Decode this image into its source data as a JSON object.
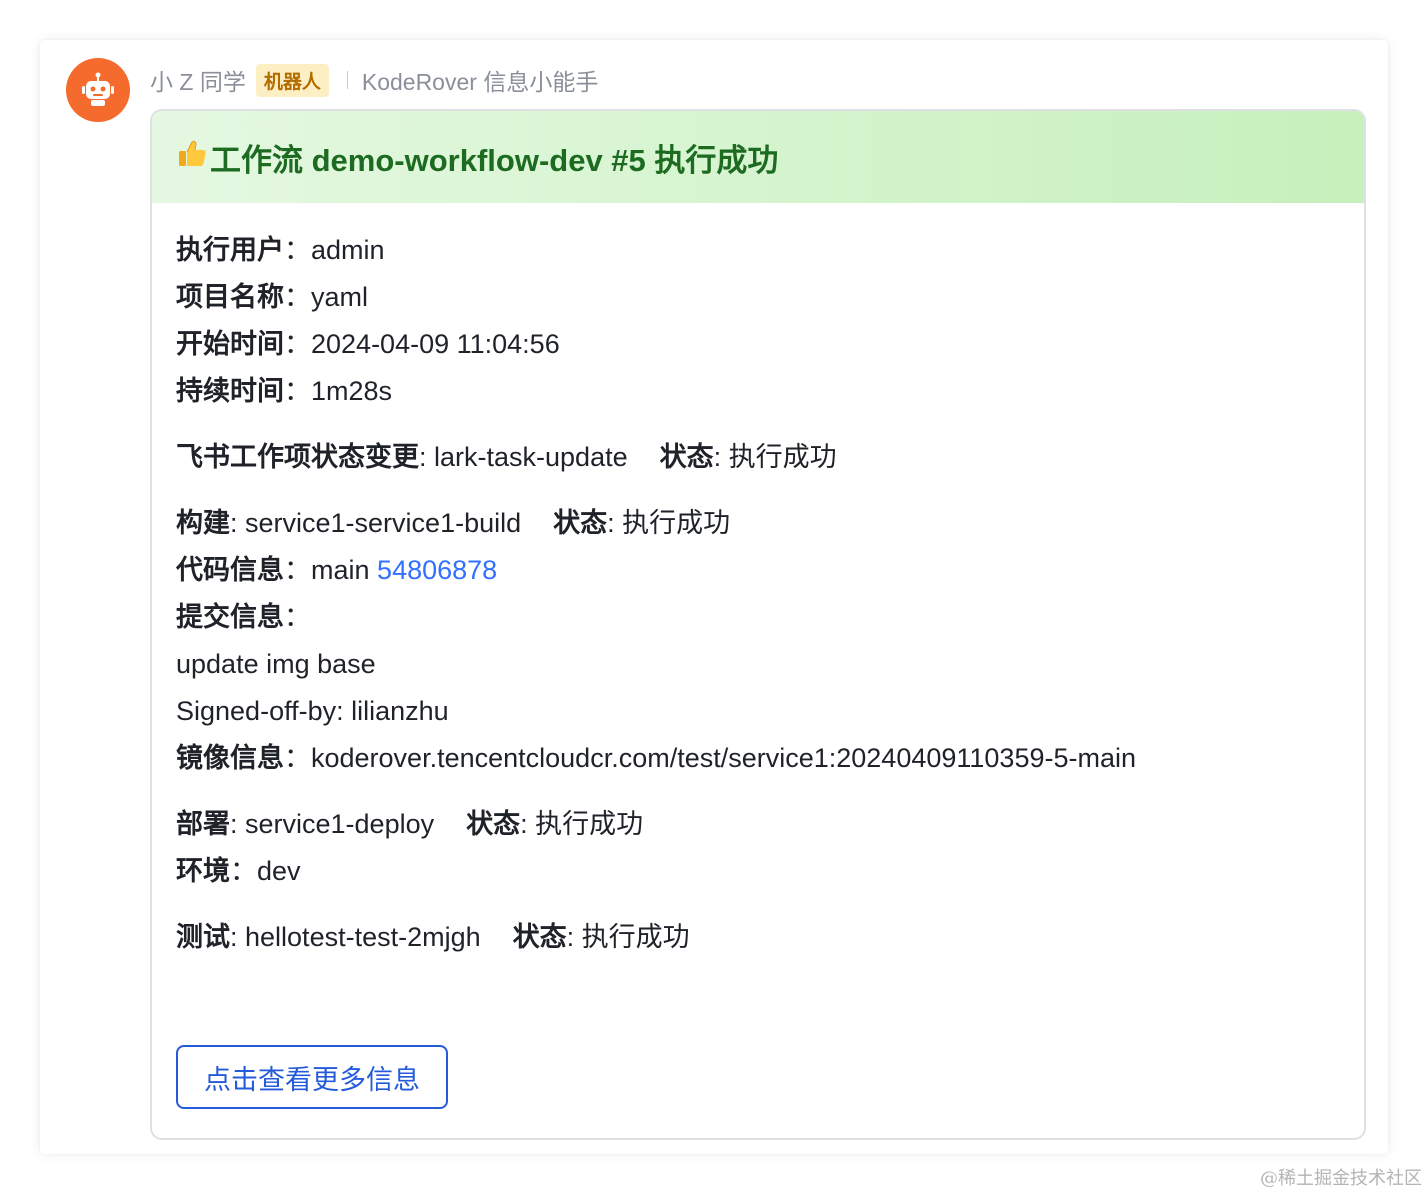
{
  "sender": {
    "name": "小 Z 同学",
    "badge": "机器人",
    "group": "KodeRover 信息小能手",
    "avatar_icon": "robot-icon",
    "avatar_color": "#f56a2d"
  },
  "card": {
    "title_icon": "thumbs-up-icon",
    "title": "工作流 demo-workflow-dev #5 执行成功",
    "header_color": "#d4f4cd",
    "summary": [
      {
        "label": "执行用户",
        "value": "admin"
      },
      {
        "label": "项目名称",
        "value": "yaml"
      },
      {
        "label": "开始时间",
        "value": "2024-04-09 11:04:56"
      },
      {
        "label": "持续时间",
        "value": "1m28s"
      }
    ],
    "lark_task": {
      "label": "飞书工作项状态变更",
      "name": "lark-task-update",
      "status_label": "状态",
      "status": "执行成功"
    },
    "build": {
      "label": "构建",
      "name": "service1-service1-build",
      "status_label": "状态",
      "status": "执行成功",
      "code_label": "代码信息",
      "branch": "main",
      "commit": "54806878",
      "commit_msg_label": "提交信息",
      "commit_msg_line1": "update img base",
      "commit_msg_line2": "Signed-off-by: lilianzhu",
      "image_label": "镜像信息",
      "image": "koderover.tencentcloudcr.com/test/service1:20240409110359-5-main"
    },
    "deploy": {
      "label": "部署",
      "name": "service1-deploy",
      "status_label": "状态",
      "status": "执行成功",
      "env_label": "环境",
      "env": "dev"
    },
    "test": {
      "label": "测试",
      "name": "hellotest-test-2mjgh",
      "status_label": "状态",
      "status": "执行成功"
    },
    "button_label": "点击查看更多信息",
    "link_color": "#3370ff"
  },
  "watermark": "@稀土掘金技术社区"
}
